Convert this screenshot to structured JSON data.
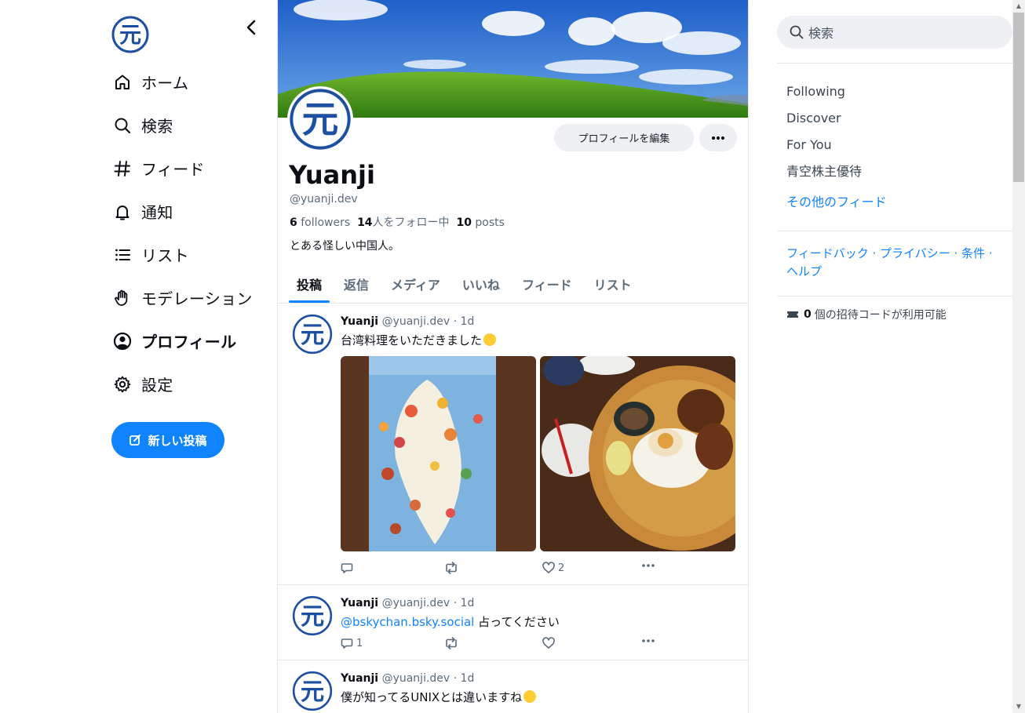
{
  "colors": {
    "accent": "#1083fe",
    "logo": "#1d4fa3"
  },
  "logo": {
    "glyph": "元"
  },
  "nav": {
    "items": [
      {
        "label": "ホーム",
        "icon": "home-icon"
      },
      {
        "label": "検索",
        "icon": "search-icon"
      },
      {
        "label": "フィード",
        "icon": "hash-icon"
      },
      {
        "label": "通知",
        "icon": "bell-icon"
      },
      {
        "label": "リスト",
        "icon": "list-icon"
      },
      {
        "label": "モデレーション",
        "icon": "hand-icon"
      },
      {
        "label": "プロフィール",
        "icon": "user-circle-icon",
        "active": true
      },
      {
        "label": "設定",
        "icon": "gear-icon"
      }
    ],
    "new_post": "新しい投稿"
  },
  "profile": {
    "name": "Yuanji",
    "handle": "@yuanji.dev",
    "followers_count": "6",
    "followers_label": "followers",
    "following_count": "14",
    "following_label": "人をフォロー中",
    "posts_count": "10",
    "posts_label": "posts",
    "bio": "とある怪しい中国人。",
    "edit_button": "プロフィールを編集"
  },
  "tabs": [
    "投稿",
    "返信",
    "メディア",
    "いいね",
    "フィード",
    "リスト"
  ],
  "posts": [
    {
      "name": "Yuanji",
      "meta": "@yuanji.dev · 1d",
      "text": "台湾料理をいただきました",
      "reply_count": "",
      "like_count": "2"
    },
    {
      "name": "Yuanji",
      "meta": "@yuanji.dev · 1d",
      "mention": "@bskychan.bsky.social",
      "text": " 占ってください",
      "reply_count": "1",
      "like_count": ""
    },
    {
      "name": "Yuanji",
      "meta": "@yuanji.dev · 1d",
      "text": "僕が知ってるUNIXとは違いますね"
    }
  ],
  "right": {
    "search_placeholder": "検索",
    "feeds": [
      "Following",
      "Discover",
      "For You",
      "青空株主優待"
    ],
    "more_feeds": "その他のフィード",
    "footer": {
      "feedback": "フィードバック",
      "privacy": "プライバシー",
      "terms": "条件",
      "help": "ヘルプ",
      "sep": " · "
    },
    "invite_count": "0",
    "invite_text": "個の招待コードが利用可能"
  }
}
